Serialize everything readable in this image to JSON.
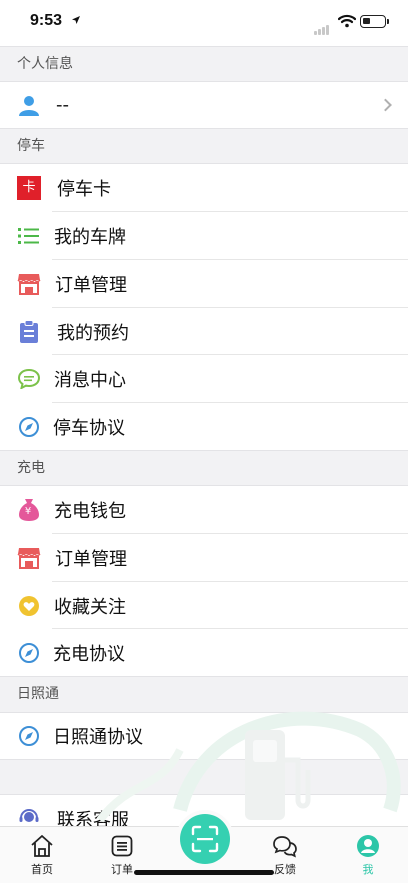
{
  "status_bar": {
    "time": "9:53"
  },
  "sections": {
    "personal": {
      "header": "个人信息",
      "name": "--"
    },
    "parking": {
      "header": "停车",
      "card_badge": "卡",
      "items": [
        "停车卡",
        "我的车牌",
        "订单管理",
        "我的预约",
        "消息中心",
        "停车协议"
      ]
    },
    "charging": {
      "header": "充电",
      "wallet_badge": "¥",
      "items": [
        "充电钱包",
        "订单管理",
        "收藏关注",
        "充电协议"
      ]
    },
    "rizhaotong": {
      "header": "日照通",
      "items": [
        "日照通协议"
      ]
    },
    "support": {
      "items": [
        "联系客服"
      ]
    }
  },
  "tabbar": {
    "tabs": [
      "首页",
      "订单",
      "反馈",
      "我"
    ],
    "active": "我"
  },
  "colors": {
    "accent": "#35d0b1",
    "parking_card_red": "#e0202a",
    "list_green": "#4cb848",
    "order_red": "#e85b5b",
    "reserve_purple": "#6a7fd8",
    "message_green": "#7cc24a",
    "protocol_blue": "#3d8fd6",
    "wallet_pink": "#e4589a",
    "favorite_yellow": "#f0c330"
  }
}
